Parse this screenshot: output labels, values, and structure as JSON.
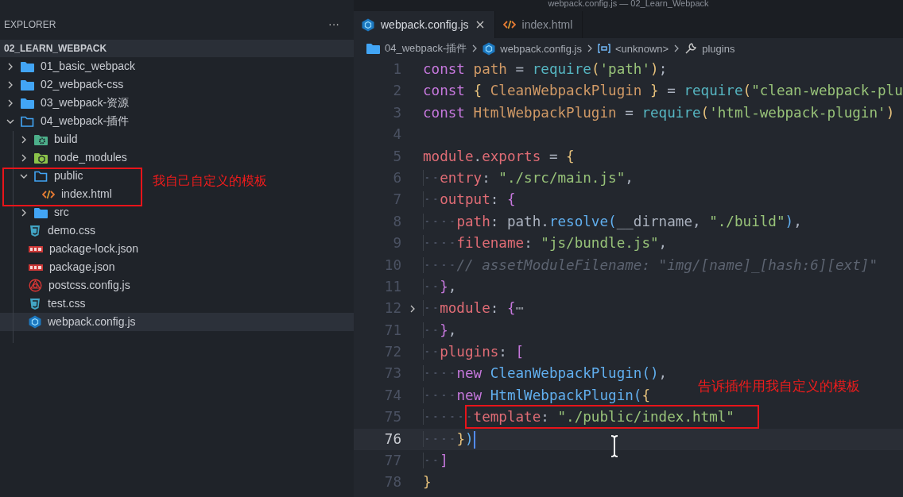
{
  "window": {
    "title": "webpack.config.js — 02_Learn_Webpack"
  },
  "sidebar": {
    "title": "EXPLORER",
    "more": "···",
    "root": "02_LEARN_WEBPACK",
    "items": [
      {
        "name": "01_basic_webpack",
        "kind": "folder",
        "expanded": false,
        "selected": false
      },
      {
        "name": "02_webpack-css",
        "kind": "folder",
        "expanded": false,
        "selected": false
      },
      {
        "name": "03_webpack-资源",
        "kind": "folder",
        "expanded": false,
        "selected": false
      },
      {
        "name": "04_webpack-插件",
        "kind": "folder",
        "expanded": true,
        "selected": false,
        "children": [
          {
            "name": "build",
            "kind": "build-folder",
            "expanded": false,
            "selected": false
          },
          {
            "name": "node_modules",
            "kind": "node-folder",
            "expanded": false,
            "selected": false
          },
          {
            "name": "public",
            "kind": "folder",
            "expanded": true,
            "selected": false,
            "children": [
              {
                "name": "index.html",
                "kind": "html",
                "selected": false
              }
            ]
          },
          {
            "name": "src",
            "kind": "folder",
            "expanded": false,
            "selected": false
          },
          {
            "name": "demo.css",
            "kind": "css",
            "selected": false
          },
          {
            "name": "package-lock.json",
            "kind": "npm",
            "selected": false
          },
          {
            "name": "package.json",
            "kind": "npm",
            "selected": false
          },
          {
            "name": "postcss.config.js",
            "kind": "postcss",
            "selected": false
          },
          {
            "name": "test.css",
            "kind": "css",
            "selected": false
          },
          {
            "name": "webpack.config.js",
            "kind": "webpack",
            "selected": true
          }
        ]
      }
    ],
    "annotation": {
      "text": "我自己自定义的模板"
    }
  },
  "editor": {
    "tabs": [
      {
        "label": "webpack.config.js",
        "kind": "webpack",
        "selected": true
      },
      {
        "label": "index.html",
        "kind": "html",
        "selected": false
      }
    ],
    "breadcrumbs": [
      {
        "text": "04_webpack-插件",
        "kind": "folder"
      },
      {
        "text": "webpack.config.js",
        "kind": "webpack"
      },
      {
        "text": "<unknown>",
        "kind": "variable"
      },
      {
        "text": "plugins",
        "kind": "property"
      }
    ],
    "lines": [
      {
        "number": "1",
        "current": false,
        "folded": false,
        "tokens": [
          {
            "kind": "kw",
            "text": "const "
          },
          {
            "kind": "var",
            "text": "path "
          },
          {
            "kind": "p",
            "text": "= "
          },
          {
            "kind": "fn2",
            "text": "require"
          },
          {
            "kind": "b1",
            "text": "("
          },
          {
            "kind": "str",
            "text": "'path'"
          },
          {
            "kind": "b1",
            "text": ")"
          },
          {
            "kind": "p",
            "text": ";"
          }
        ]
      },
      {
        "number": "2",
        "current": false,
        "folded": false,
        "tokens": [
          {
            "kind": "kw",
            "text": "const "
          },
          {
            "kind": "b1",
            "text": "{ "
          },
          {
            "kind": "var",
            "text": "CleanWebpackPlugin "
          },
          {
            "kind": "b1",
            "text": "} "
          },
          {
            "kind": "p",
            "text": "= "
          },
          {
            "kind": "fn2",
            "text": "require"
          },
          {
            "kind": "b1",
            "text": "("
          },
          {
            "kind": "str",
            "text": "\"clean-webpack-plu"
          }
        ]
      },
      {
        "number": "3",
        "current": false,
        "folded": false,
        "tokens": [
          {
            "kind": "kw",
            "text": "const "
          },
          {
            "kind": "var",
            "text": "HtmlWebpackPlugin "
          },
          {
            "kind": "p",
            "text": "= "
          },
          {
            "kind": "fn2",
            "text": "require"
          },
          {
            "kind": "b1",
            "text": "("
          },
          {
            "kind": "str",
            "text": "'html-webpack-plugin'"
          },
          {
            "kind": "b1",
            "text": ")"
          }
        ]
      },
      {
        "number": "4",
        "current": false,
        "folded": false
      },
      {
        "number": "5",
        "current": false,
        "folded": false,
        "tokens": [
          {
            "kind": "prop",
            "text": "module"
          },
          {
            "kind": "p",
            "text": "."
          },
          {
            "kind": "prop",
            "text": "exports "
          },
          {
            "kind": "p",
            "text": "= "
          },
          {
            "kind": "b1",
            "text": "{"
          }
        ]
      },
      {
        "number": "6",
        "current": false,
        "folded": false,
        "tokens": [
          {
            "kind": "prop",
            "text": "  entry"
          },
          {
            "kind": "p",
            "text": ": "
          },
          {
            "kind": "str",
            "text": "\"./src/main.js\""
          },
          {
            "kind": "p",
            "text": ","
          }
        ]
      },
      {
        "number": "7",
        "current": false,
        "folded": false,
        "tokens": [
          {
            "kind": "prop",
            "text": "  output"
          },
          {
            "kind": "p",
            "text": ": "
          },
          {
            "kind": "b2",
            "text": "{"
          }
        ]
      },
      {
        "number": "8",
        "current": false,
        "folded": false,
        "tokens": [
          {
            "kind": "prop",
            "text": "    path"
          },
          {
            "kind": "p",
            "text": ": path."
          },
          {
            "kind": "fn",
            "text": "resolve"
          },
          {
            "kind": "b3",
            "text": "("
          },
          {
            "kind": "p",
            "text": "__dirname, "
          },
          {
            "kind": "str",
            "text": "\"./build\""
          },
          {
            "kind": "b3",
            "text": ")"
          },
          {
            "kind": "p",
            "text": ","
          }
        ]
      },
      {
        "number": "9",
        "current": false,
        "folded": false,
        "tokens": [
          {
            "kind": "prop",
            "text": "    filename"
          },
          {
            "kind": "p",
            "text": ": "
          },
          {
            "kind": "str",
            "text": "\"js/bundle.js\""
          },
          {
            "kind": "p",
            "text": ","
          }
        ]
      },
      {
        "number": "10",
        "current": false,
        "folded": false,
        "tokens": [
          {
            "kind": "cm",
            "text": "    // assetModuleFilename: \"img/[name]_[hash:6][ext]\""
          }
        ]
      },
      {
        "number": "11",
        "current": false,
        "folded": false,
        "tokens": [
          {
            "kind": "b2",
            "text": "  }"
          },
          {
            "kind": "p",
            "text": ","
          }
        ]
      },
      {
        "number": "12",
        "current": false,
        "folded": true,
        "tokens": [
          {
            "kind": "prop",
            "text": "  module"
          },
          {
            "kind": "p",
            "text": ": "
          },
          {
            "kind": "b2",
            "text": "{"
          },
          {
            "kind": "fold",
            "text": "⋯"
          }
        ]
      },
      {
        "number": "71",
        "current": false,
        "folded": false,
        "tokens": [
          {
            "kind": "b2",
            "text": "  }"
          },
          {
            "kind": "p",
            "text": ","
          }
        ]
      },
      {
        "number": "72",
        "current": false,
        "folded": false,
        "tokens": [
          {
            "kind": "prop",
            "text": "  plugins"
          },
          {
            "kind": "p",
            "text": ": "
          },
          {
            "kind": "b2",
            "text": "["
          }
        ]
      },
      {
        "number": "73",
        "current": false,
        "folded": false,
        "tokens": [
          {
            "kind": "kw",
            "text": "    new "
          },
          {
            "kind": "fn",
            "text": "CleanWebpackPlugin"
          },
          {
            "kind": "b3",
            "text": "()"
          },
          {
            "kind": "p",
            "text": ","
          }
        ]
      },
      {
        "number": "74",
        "current": false,
        "folded": false,
        "tokens": [
          {
            "kind": "kw",
            "text": "    new "
          },
          {
            "kind": "fn",
            "text": "HtmlWebpackPlugin"
          },
          {
            "kind": "b3",
            "text": "("
          },
          {
            "kind": "b1",
            "text": "{"
          }
        ]
      },
      {
        "number": "75",
        "current": false,
        "folded": false,
        "tokens": [
          {
            "kind": "prop",
            "text": "      template"
          },
          {
            "kind": "p",
            "text": ": "
          },
          {
            "kind": "str",
            "text": "\"./public/index.html\""
          }
        ]
      },
      {
        "number": "76",
        "current": true,
        "folded": false,
        "tokens": [
          {
            "kind": "b1",
            "text": "    }"
          },
          {
            "kind": "b3",
            "text": ")"
          }
        ]
      },
      {
        "number": "77",
        "current": false,
        "folded": false,
        "tokens": [
          {
            "kind": "b2",
            "text": "  ]"
          }
        ]
      },
      {
        "number": "78",
        "current": false,
        "folded": false,
        "tokens": [
          {
            "kind": "b1",
            "text": "}"
          }
        ]
      }
    ],
    "annotation": {
      "text": "告诉插件用我自定义的模板"
    }
  }
}
